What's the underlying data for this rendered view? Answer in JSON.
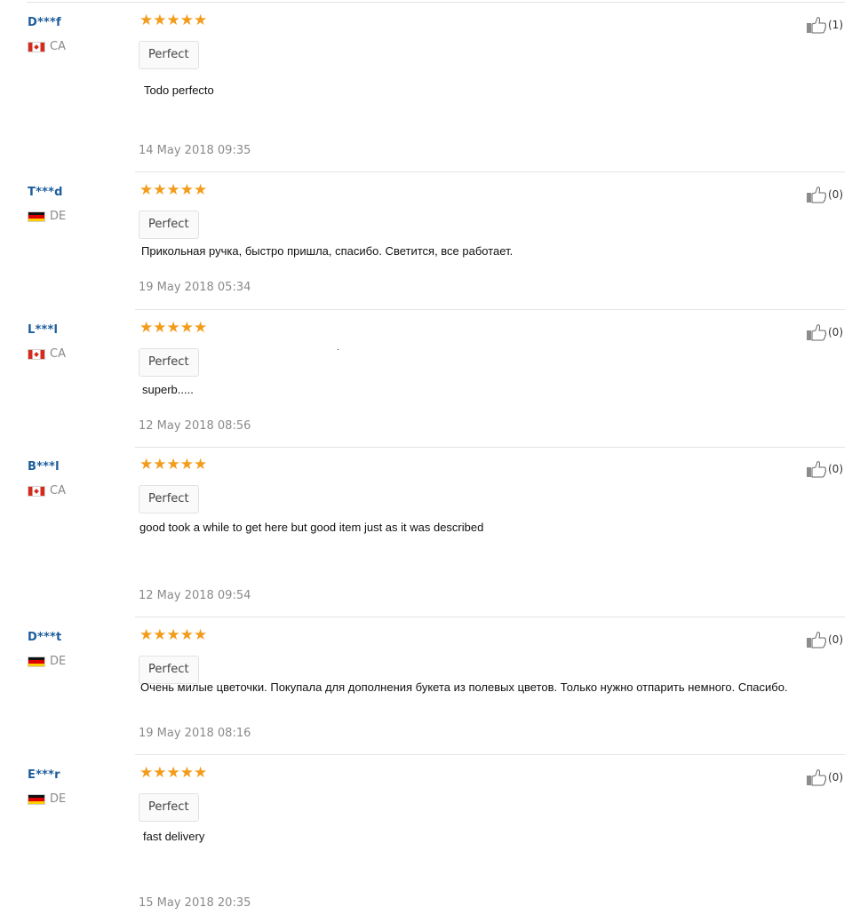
{
  "reviews": [
    {
      "user": "D***f",
      "country": "CA",
      "flag": "ca",
      "stars": "★★★★★",
      "rating": 5,
      "tag": "Perfect",
      "text": "Todo perfecto",
      "date": "14 May 2018 09:35",
      "likes": "(1)"
    },
    {
      "user": "T***d",
      "country": "DE",
      "flag": "de",
      "stars": "★★★★★",
      "rating": 5,
      "tag": "Perfect",
      "text": "Прикольная ручка, быстро пришла, спасибо. Светится, все работает.",
      "date": "19 May 2018 05:34",
      "likes": "(0)"
    },
    {
      "user": "L***l",
      "country": "CA",
      "flag": "ca",
      "stars": "★★★★★",
      "rating": 5,
      "tag": "Perfect",
      "text": "superb.....",
      "date": "12 May 2018 08:56",
      "likes": "(0)"
    },
    {
      "user": "B***l",
      "country": "CA",
      "flag": "ca",
      "stars": "★★★★★",
      "rating": 5,
      "tag": "Perfect",
      "text": "good took a while to get here but good item just as it was described",
      "date": "12 May 2018 09:54",
      "likes": "(0)"
    },
    {
      "user": "D***t",
      "country": "DE",
      "flag": "de",
      "stars": "★★★★★",
      "rating": 5,
      "tag": "Perfect",
      "text": "Очень милые цветочки. Покупала для дополнения букета из полевых цветов. Только нужно отпарить немного. Спасибо.",
      "date": "19 May 2018 08:16",
      "likes": "(0)"
    },
    {
      "user": "E***r",
      "country": "DE",
      "flag": "de",
      "stars": "★★★★★",
      "rating": 5,
      "tag": "Perfect",
      "text": "fast delivery",
      "date": "15 May 2018 20:35",
      "likes": "(0)"
    }
  ],
  "icons": {
    "like": "thumbs-up-icon",
    "star": "star-icon"
  },
  "colors": {
    "username": "#1c5d9c",
    "star": "#f39c1b",
    "meta": "#8a8a8a"
  }
}
